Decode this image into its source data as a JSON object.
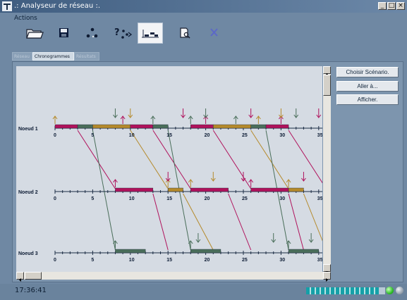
{
  "window": {
    "title": ".: Analyseur de réseau :.",
    "controls": [
      "_",
      "□",
      "×"
    ]
  },
  "actions": {
    "label": "Actions",
    "buttons": [
      {
        "icon": "folder-open-icon",
        "active": false
      },
      {
        "icon": "floppy-disk-icon",
        "active": false
      },
      {
        "icon": "network-nodes-icon",
        "active": false
      },
      {
        "icon": "question-network-icon",
        "active": false
      },
      {
        "icon": "timeline-chart-icon",
        "active": true
      },
      {
        "icon": "document-magnifier-icon",
        "active": false
      },
      {
        "icon": "close-x-icon",
        "active": false
      }
    ]
  },
  "tabs": [
    {
      "label": "Réseau",
      "active": false
    },
    {
      "label": "Chronogrammes",
      "active": true
    },
    {
      "label": "Résultats",
      "active": false
    }
  ],
  "side_buttons": {
    "choose_scenario": "Choisir Scénario.",
    "go_to": "Aller à...",
    "display": "Afficher."
  },
  "chart": {
    "colors": {
      "pink": "#b0125c",
      "green": "#4a6e5a",
      "gold": "#b58a2b"
    },
    "x_ticks": [
      0,
      5,
      10,
      15,
      20,
      25,
      30,
      35
    ],
    "nodes": [
      {
        "name": "Noeud 1",
        "bars": [
          {
            "start": 0,
            "end": 3,
            "color": "pink"
          },
          {
            "start": 3,
            "end": 5,
            "color": "green"
          },
          {
            "start": 5,
            "end": 10,
            "color": "gold"
          },
          {
            "start": 10,
            "end": 13,
            "color": "pink"
          },
          {
            "start": 13,
            "end": 15,
            "color": "green"
          },
          {
            "start": 18,
            "end": 21,
            "color": "pink"
          },
          {
            "start": 21,
            "end": 26,
            "color": "gold"
          },
          {
            "start": 26,
            "end": 28,
            "color": "green"
          },
          {
            "start": 28,
            "end": 31,
            "color": "pink"
          }
        ],
        "up_arrows": [
          {
            "t": 0,
            "color": "gold"
          },
          {
            "t": 9,
            "color": "pink"
          },
          {
            "t": 13,
            "color": "green"
          },
          {
            "t": 18,
            "color": "green"
          },
          {
            "t": 20,
            "color": "pink"
          },
          {
            "t": 24,
            "color": "green"
          },
          {
            "t": 27,
            "color": "gold"
          },
          {
            "t": 30,
            "color": "pink"
          }
        ],
        "down_arrows": [
          {
            "t": 8,
            "color": "green"
          },
          {
            "t": 10,
            "color": "gold"
          },
          {
            "t": 17,
            "color": "pink"
          },
          {
            "t": 20,
            "color": "green"
          },
          {
            "t": 26,
            "color": "pink"
          },
          {
            "t": 30,
            "color": "gold"
          },
          {
            "t": 32,
            "color": "green"
          },
          {
            "t": 35,
            "color": "pink"
          }
        ]
      },
      {
        "name": "Noeud 2",
        "bars": [
          {
            "start": 8,
            "end": 13,
            "color": "pink"
          },
          {
            "start": 15,
            "end": 17,
            "color": "gold"
          },
          {
            "start": 18,
            "end": 23,
            "color": "pink"
          },
          {
            "start": 26,
            "end": 31,
            "color": "pink"
          },
          {
            "start": 31,
            "end": 33,
            "color": "gold"
          }
        ],
        "up_arrows": [
          {
            "t": 8,
            "color": "pink"
          },
          {
            "t": 15,
            "color": "gold"
          },
          {
            "t": 18,
            "color": "gold"
          },
          {
            "t": 26,
            "color": "pink"
          },
          {
            "t": 31,
            "color": "gold"
          }
        ],
        "down_arrows": [
          {
            "t": 15,
            "color": "pink"
          },
          {
            "t": 21,
            "color": "gold"
          },
          {
            "t": 25,
            "color": "pink"
          },
          {
            "t": 33,
            "color": "pink"
          }
        ]
      },
      {
        "name": "Noeud 3",
        "bars": [
          {
            "start": 8,
            "end": 12,
            "color": "green"
          },
          {
            "start": 18,
            "end": 22,
            "color": "green"
          },
          {
            "start": 31,
            "end": 35,
            "color": "green"
          }
        ],
        "up_arrows": [
          {
            "t": 8,
            "color": "green"
          },
          {
            "t": 18,
            "color": "green"
          },
          {
            "t": 31,
            "color": "green"
          }
        ],
        "down_arrows": [
          {
            "t": 19,
            "color": "green"
          },
          {
            "t": 29,
            "color": "green"
          },
          {
            "t": 34,
            "color": "green"
          }
        ]
      }
    ],
    "links": [
      {
        "from_node": 0,
        "from_t": 3,
        "to_node": 1,
        "to_t": 8,
        "color": "pink"
      },
      {
        "from_node": 0,
        "from_t": 5,
        "to_node": 2,
        "to_t": 8,
        "color": "green"
      },
      {
        "from_node": 0,
        "from_t": 10,
        "to_node": 1,
        "to_t": 15,
        "color": "gold"
      },
      {
        "from_node": 0,
        "from_t": 13,
        "to_node": 1,
        "to_t": 18,
        "color": "pink"
      },
      {
        "from_node": 0,
        "from_t": 15,
        "to_node": 2,
        "to_t": 18,
        "color": "green"
      },
      {
        "from_node": 0,
        "from_t": 21,
        "to_node": 1,
        "to_t": 26,
        "color": "pink"
      },
      {
        "from_node": 0,
        "from_t": 26,
        "to_node": 1,
        "to_t": 31,
        "color": "gold"
      },
      {
        "from_node": 0,
        "from_t": 28,
        "to_node": 2,
        "to_t": 31,
        "color": "green"
      },
      {
        "from_node": 0,
        "from_t": 31,
        "to_node": 1,
        "to_t": 36,
        "color": "pink"
      },
      {
        "from_node": 1,
        "from_t": 13,
        "to_node": 2,
        "to_t": 15,
        "color": "pink"
      },
      {
        "from_node": 1,
        "from_t": 17,
        "to_node": 2,
        "to_t": 21,
        "color": "gold"
      },
      {
        "from_node": 1,
        "from_t": 23,
        "to_node": 2,
        "to_t": 26,
        "color": "pink"
      },
      {
        "from_node": 1,
        "from_t": 31,
        "to_node": 2,
        "to_t": 33,
        "color": "pink"
      },
      {
        "from_node": 1,
        "from_t": 33,
        "to_node": 2,
        "to_t": 36,
        "color": "gold"
      }
    ]
  },
  "status": {
    "time": "17:36:41",
    "progress": 0.92
  }
}
